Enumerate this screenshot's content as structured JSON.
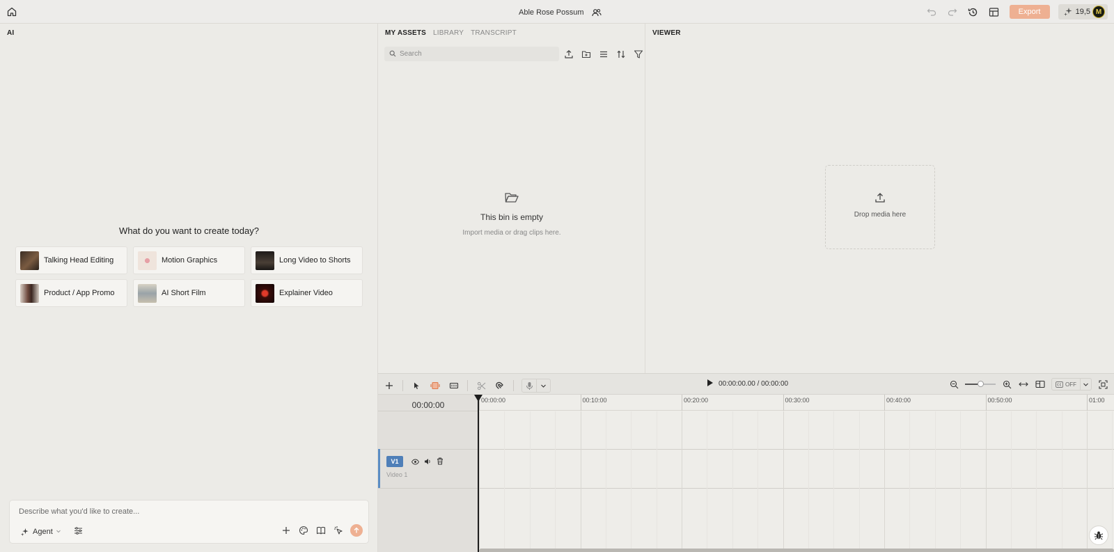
{
  "topbar": {
    "project_name": "Able Rose Possum",
    "export_label": "Export",
    "credits": "19,5",
    "avatar_initial": "M"
  },
  "ai_panel": {
    "label": "AI",
    "heading": "What do you want to create today?",
    "templates": [
      {
        "label": "Talking Head Editing",
        "thumb": "#5a4636"
      },
      {
        "label": "Motion Graphics",
        "thumb": "#ece2d8"
      },
      {
        "label": "Long Video to Shorts",
        "thumb": "#2f2b28"
      },
      {
        "label": "Product / App Promo",
        "thumb": "#8f6a5a"
      },
      {
        "label": "AI Short Film",
        "thumb": "#c9c3b6"
      },
      {
        "label": "Explainer Video",
        "thumb": "#1a0808"
      }
    ],
    "prompt_placeholder": "Describe what you'd like to create...",
    "mode_label": "Agent"
  },
  "assets": {
    "tabs": [
      "MY ASSETS",
      "LIBRARY",
      "TRANSCRIPT"
    ],
    "active_tab": "MY ASSETS",
    "search_placeholder": "Search",
    "empty_title": "This bin is empty",
    "empty_subtitle": "Import media or drag clips here."
  },
  "viewer": {
    "label": "VIEWER",
    "drop_label": "Drop media here"
  },
  "timeline": {
    "timecode": "00:00:00.00 / 00:00:00",
    "current_time": "00:00:00",
    "ruler_labels": [
      "00:00:00",
      "00:10:00",
      "00:20:00",
      "00:30:00",
      "00:40:00",
      "00:50:00",
      "01:00"
    ],
    "zoom_level": 0.5,
    "captions_label": "OFF",
    "track": {
      "badge": "V1",
      "name": "Video 1"
    }
  },
  "colors": {
    "accent": "#eeb092",
    "track_accent": "#4f7fb8",
    "background": "#ecebe7"
  }
}
